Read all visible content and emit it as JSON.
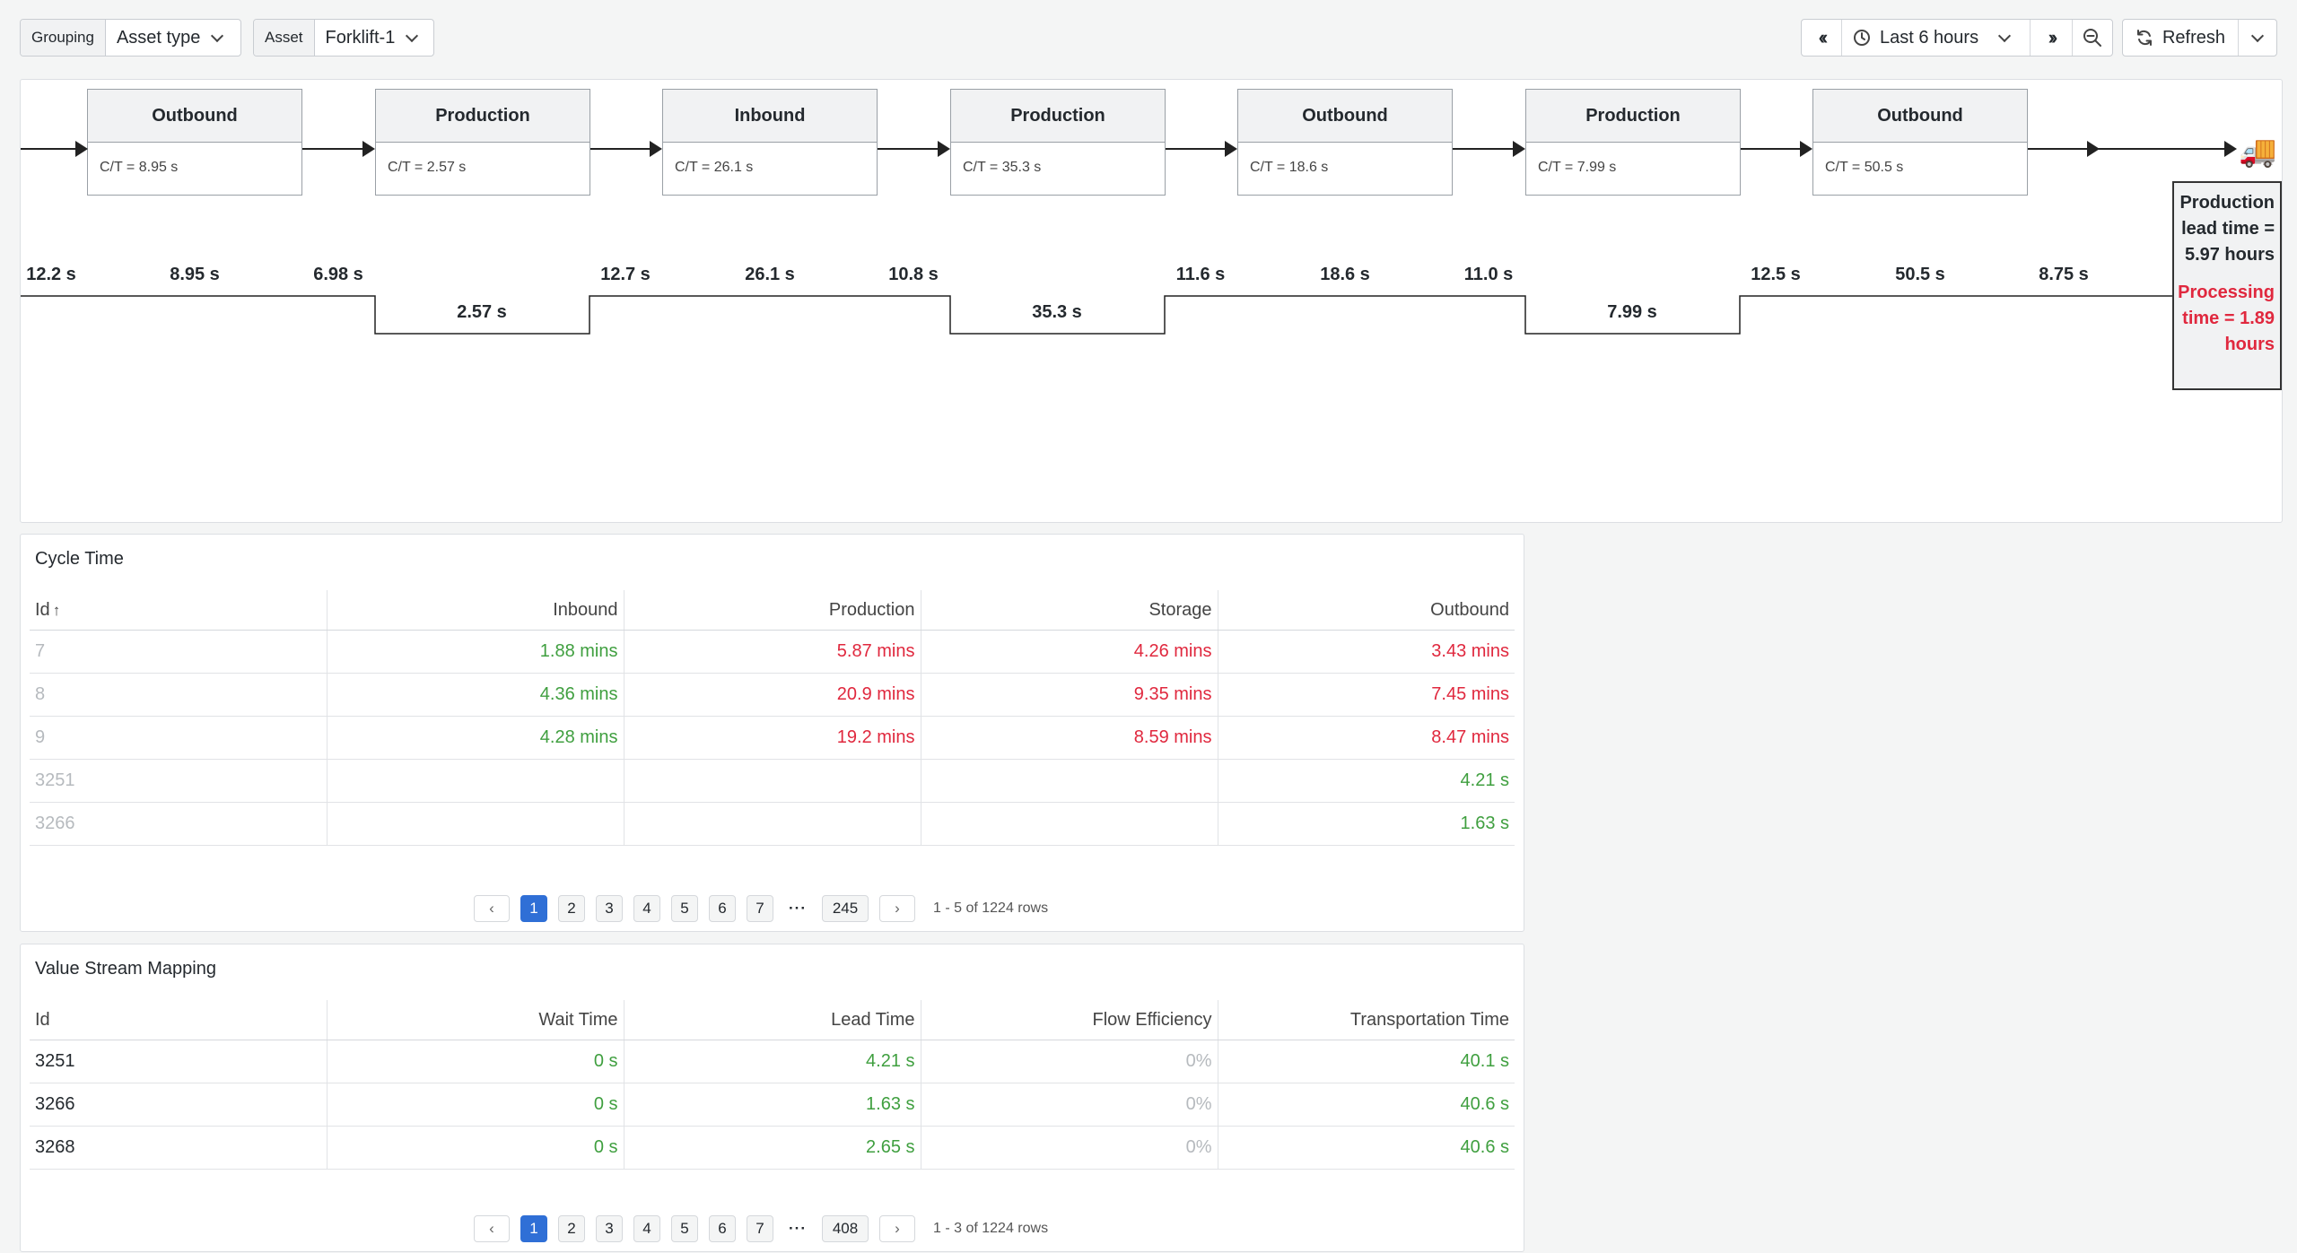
{
  "toolbar": {
    "grouping_label": "Grouping",
    "grouping_value": "Asset type",
    "asset_label": "Asset",
    "asset_value": "Forklift-1",
    "time_range": "Last 6 hours",
    "refresh_label": "Refresh"
  },
  "vsm": {
    "steps": [
      {
        "name": "Outbound",
        "ct": "C/T = 8.95 s"
      },
      {
        "name": "Production",
        "ct": "C/T = 2.57 s"
      },
      {
        "name": "Inbound",
        "ct": "C/T = 26.1 s"
      },
      {
        "name": "Production",
        "ct": "C/T = 35.3 s"
      },
      {
        "name": "Outbound",
        "ct": "C/T = 18.6 s"
      },
      {
        "name": "Production",
        "ct": "C/T = 7.99 s"
      },
      {
        "name": "Outbound",
        "ct": "C/T = 50.5 s"
      }
    ],
    "timeline_top": [
      "12.2 s",
      "8.95 s",
      "6.98 s",
      "12.7 s",
      "26.1 s",
      "10.8 s",
      "11.6 s",
      "18.6 s",
      "11.0 s",
      "12.5 s",
      "50.5 s",
      "8.75 s"
    ],
    "timeline_bottom": [
      "2.57 s",
      "35.3 s",
      "7.99 s"
    ],
    "lead_time_text": "Production lead time = 5.97 hours",
    "processing_time_text": "Processing time = 1.89 hours",
    "truck_icon": "truck-icon"
  },
  "cycle_time": {
    "title": "Cycle Time",
    "columns": [
      "Id",
      "Inbound",
      "Production",
      "Storage",
      "Outbound"
    ],
    "rows": [
      {
        "id": "7",
        "inbound": "1.88 mins",
        "production": "5.87 mins",
        "storage": "4.26 mins",
        "outbound": "3.43 mins"
      },
      {
        "id": "8",
        "inbound": "4.36 mins",
        "production": "20.9 mins",
        "storage": "9.35 mins",
        "outbound": "7.45 mins"
      },
      {
        "id": "9",
        "inbound": "4.28 mins",
        "production": "19.2 mins",
        "storage": "8.59 mins",
        "outbound": "8.47 mins"
      },
      {
        "id": "3251",
        "inbound": "",
        "production": "",
        "storage": "",
        "outbound": "4.21 s"
      },
      {
        "id": "3266",
        "inbound": "",
        "production": "",
        "storage": "",
        "outbound": "1.63 s"
      }
    ],
    "pages": [
      "1",
      "2",
      "3",
      "4",
      "5",
      "6",
      "7",
      "245"
    ],
    "row_count": "1 - 5 of 1224 rows"
  },
  "value_stream": {
    "title": "Value Stream Mapping",
    "columns": [
      "Id",
      "Wait Time",
      "Lead Time",
      "Flow Efficiency",
      "Transportation Time"
    ],
    "rows": [
      {
        "id": "3251",
        "wait": "0 s",
        "lead": "4.21 s",
        "flow": "0%",
        "transport": "40.1 s"
      },
      {
        "id": "3266",
        "wait": "0 s",
        "lead": "1.63 s",
        "flow": "0%",
        "transport": "40.6 s"
      },
      {
        "id": "3268",
        "wait": "0 s",
        "lead": "2.65 s",
        "flow": "0%",
        "transport": "40.6 s"
      }
    ],
    "pages": [
      "1",
      "2",
      "3",
      "4",
      "5",
      "6",
      "7",
      "408"
    ],
    "row_count": "1 - 3 of 1224 rows"
  },
  "colors": {
    "good": "#3f9f3f",
    "bad": "#e0283e",
    "muted": "#b6babe",
    "active_page": "#2f6fd6"
  }
}
